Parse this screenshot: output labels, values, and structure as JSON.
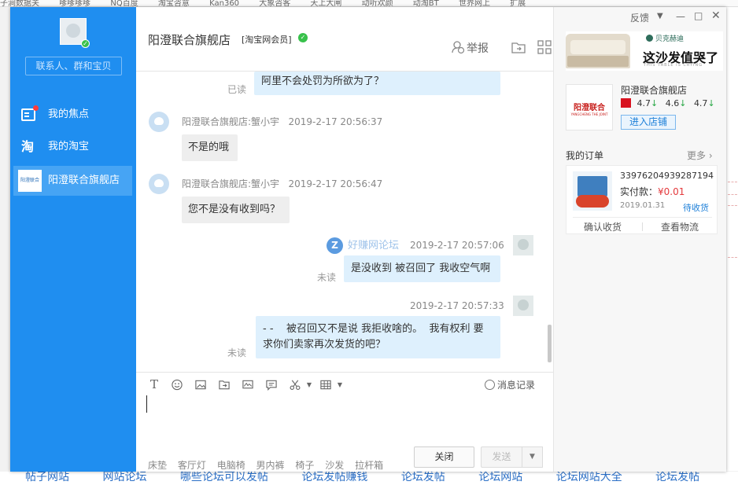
{
  "background": {
    "top_tabs": [
      "子涧数据关",
      "嗲嗲嗲嗲",
      "NQ百度",
      "淘宝咨意",
      "Kan360",
      "大象咨客",
      "天上大闸",
      "动听欢颜",
      "动淘BT",
      "世界网上",
      "扩展"
    ],
    "bottom_links": [
      "帖子网站",
      "网站论坛",
      "哪些论坛可以发帖",
      "论坛发帖赚钱",
      "论坛发帖",
      "论坛网站",
      "论坛网站大全",
      "论坛发帖"
    ]
  },
  "sidebar": {
    "search_placeholder": "联系人、群和宝贝",
    "items": [
      {
        "label": "我的焦点"
      },
      {
        "label": "我的淘宝"
      },
      {
        "label": "阳澄联合旗舰店"
      }
    ]
  },
  "chat": {
    "title": "阳澄联合旗舰店",
    "member_badge": "[淘宝网会员]",
    "report_label": "举报",
    "messages": {
      "m1": {
        "text": "阿里不会处罚为所欲为了？",
        "status": "已读"
      },
      "m2": {
        "sender": "阳澄联合旗舰店:蟹小宇",
        "time": "2019-2-17 20:56:37",
        "text": "不是的哦"
      },
      "m3": {
        "sender": "阳澄联合旗舰店:蟹小宇",
        "time": "2019-2-17 20:56:47",
        "text": "您不是没有收到吗？"
      },
      "m4": {
        "time": "2019-2-17 20:57:06",
        "text": "是没收到 被召回了 我收空气啊",
        "status": "未读"
      },
      "m5": {
        "time": "2019-2-17 20:57:33",
        "text_line1": "- -    被召回又不是说 我拒收啥的。  我有权利 要",
        "text_line2": "求你们卖家再次发货的吧？",
        "status": "未读"
      }
    },
    "watermark": "好赚网论坛",
    "history_label": "消息记录",
    "quick_replies": [
      "床垫",
      "客厅灯",
      "电脑椅",
      "男内裤",
      "椅子",
      "沙发",
      "拉杆箱"
    ],
    "close_label": "关闭",
    "send_label": "发送"
  },
  "right_panel": {
    "feedback_label": "反馈",
    "banner": {
      "brand": "贝克赫迪",
      "title": "这沙发值哭了",
      "subtitle": "THIS TABLE IS CRYING"
    },
    "shop": {
      "logo_text": "阳澄联合",
      "logo_sub": "YANGCHENG THE JOINT",
      "name": "阳澄联合旗舰店",
      "ratings": [
        "4.7",
        "4.6",
        "4.7"
      ],
      "enter_label": "进入店铺"
    },
    "orders": {
      "label": "我的订单",
      "more_label": "更多",
      "item": {
        "id": "33976204939287194",
        "pay_label": "实付款：",
        "amount": "¥0.01",
        "date": "2019.01.31",
        "status": "待收货",
        "confirm_label": "确认收货",
        "logistics_label": "查看物流"
      }
    }
  }
}
